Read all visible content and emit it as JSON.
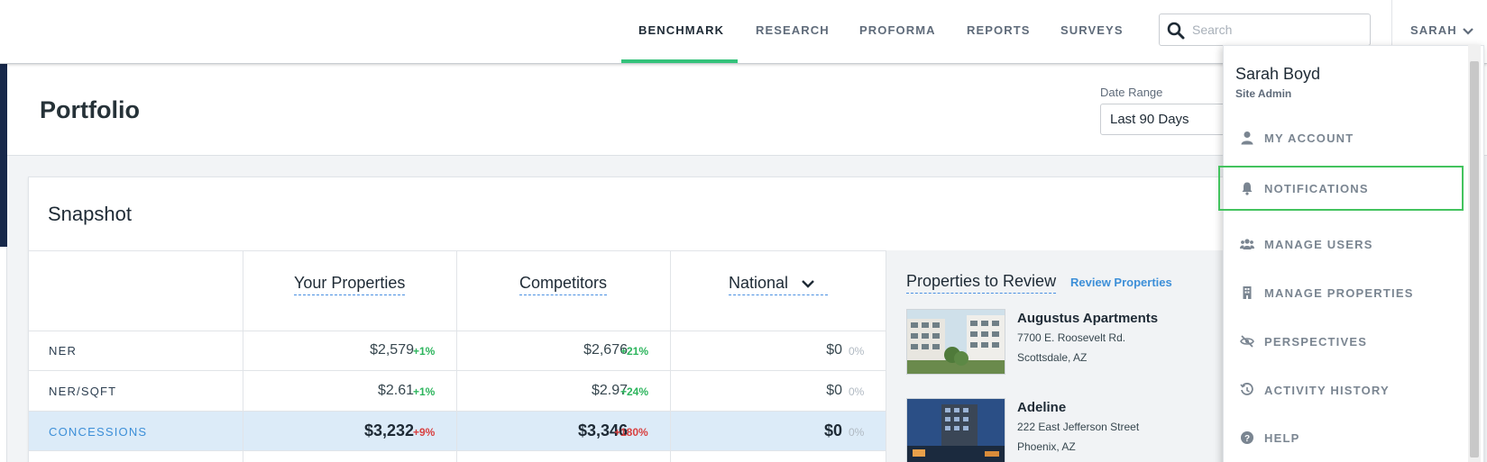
{
  "nav": {
    "items": [
      {
        "label": "BENCHMARK",
        "active": true
      },
      {
        "label": "RESEARCH",
        "active": false
      },
      {
        "label": "PROFORMA",
        "active": false
      },
      {
        "label": "REPORTS",
        "active": false
      },
      {
        "label": "SURVEYS",
        "active": false
      }
    ],
    "search_placeholder": "Search",
    "user_label": "SARAH",
    "accent_color": "#34c27a"
  },
  "header": {
    "title": "Portfolio",
    "date_range_label": "Date Range",
    "date_range_value": "Last 90 Days"
  },
  "snapshot": {
    "title": "Snapshot",
    "columns": [
      "Your Properties",
      "Competitors",
      "National"
    ],
    "rows": [
      {
        "label": "NER",
        "your": "$2,579",
        "your_pct": "+1%",
        "comp": "$2,676",
        "comp_pct": "+21%",
        "nat": "$0",
        "nat_pct": "0%"
      },
      {
        "label": "NER/SQFT",
        "your": "$2.61",
        "your_pct": "+1%",
        "comp": "$2.97",
        "comp_pct": "+24%",
        "nat": "$0",
        "nat_pct": "0%"
      },
      {
        "label": "CONCESSIONS",
        "your": "$3,232",
        "your_pct": "+9%",
        "comp": "$3,346",
        "comp_pct": "+180%",
        "nat": "$0",
        "nat_pct": "0%"
      }
    ]
  },
  "review": {
    "title": "Properties to Review",
    "link": "Review Properties",
    "properties": [
      {
        "name": "Augustus Apartments",
        "address": "7700 E. Roosevelt Rd.",
        "city": "Scottsdale, AZ"
      },
      {
        "name": "Adeline",
        "address": "222 East Jefferson Street",
        "city": "Phoenix, AZ"
      }
    ]
  },
  "user_menu": {
    "name": "Sarah Boyd",
    "role": "Site Admin",
    "items": [
      {
        "label": "MY ACCOUNT",
        "icon": "user-icon"
      },
      {
        "label": "NOTIFICATIONS",
        "icon": "bell-icon"
      },
      {
        "label": "MANAGE USERS",
        "icon": "users-icon"
      },
      {
        "label": "MANAGE PROPERTIES",
        "icon": "building-icon"
      },
      {
        "label": "PERSPECTIVES",
        "icon": "eye-slash-icon"
      },
      {
        "label": "ACTIVITY HISTORY",
        "icon": "history-icon"
      },
      {
        "label": "HELP",
        "icon": "help-icon"
      }
    ]
  }
}
